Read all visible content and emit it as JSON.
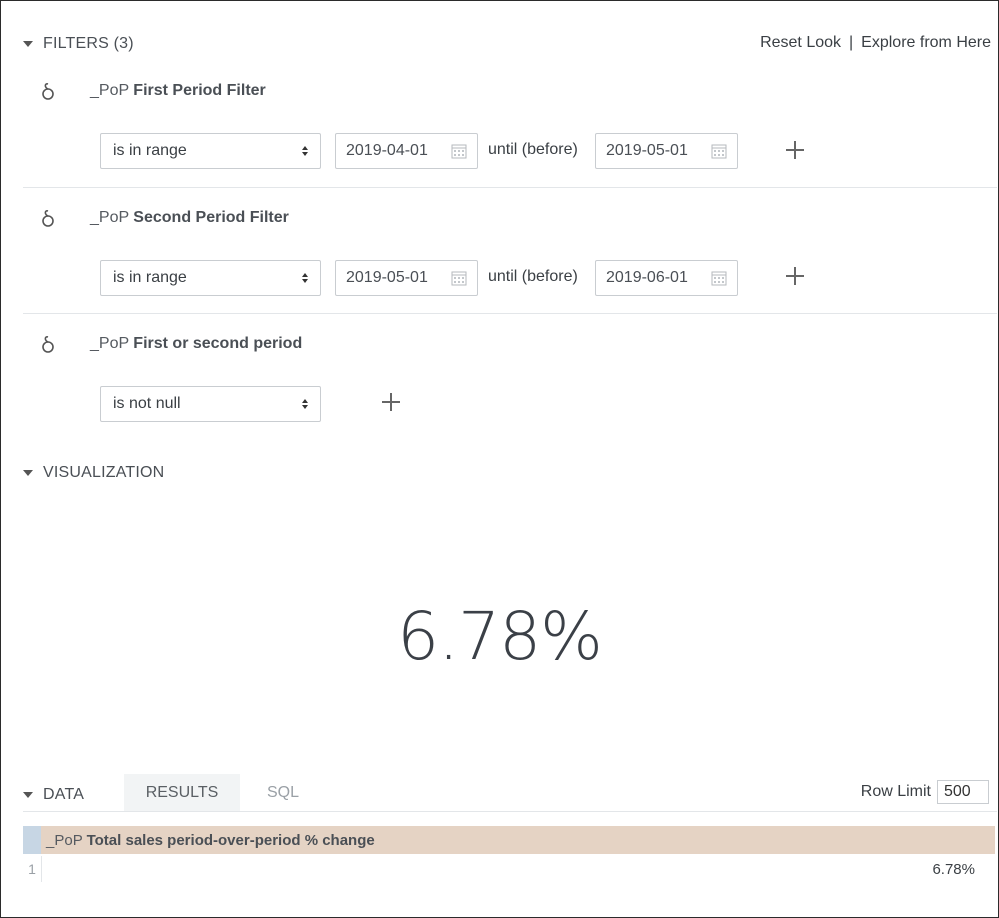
{
  "toolbar": {
    "reset_look": "Reset Look",
    "separator": "|",
    "explore": "Explore from Here"
  },
  "filters": {
    "header": "FILTERS (3)",
    "items": [
      {
        "prefix": "_PoP ",
        "name": "First Period Filter",
        "operator": "is in range",
        "from": "2019-04-01",
        "until_label": "until (before)",
        "to": "2019-05-01"
      },
      {
        "prefix": "_PoP ",
        "name": "Second Period Filter",
        "operator": "is in range",
        "from": "2019-05-01",
        "until_label": "until (before)",
        "to": "2019-06-01"
      },
      {
        "prefix": "_PoP ",
        "name": "First or second period",
        "operator": "is not null"
      }
    ]
  },
  "visualization": {
    "header": "VISUALIZATION",
    "value": "6.78%"
  },
  "data": {
    "header": "DATA",
    "tabs": [
      "RESULTS",
      "SQL"
    ],
    "row_limit_label": "Row Limit",
    "row_limit_value": "500",
    "column_prefix": "_PoP ",
    "column_name": "Total sales period-over-period % change",
    "rows": [
      {
        "index": "1",
        "value": "6.78%"
      }
    ]
  },
  "icons": {
    "field": "field-icon",
    "calendar": "calendar-icon",
    "add": "plus-icon",
    "collapse": "caret-down-icon"
  },
  "colors": {
    "results_header": "#e5d3c4",
    "index_header": "#c7d6e4"
  }
}
